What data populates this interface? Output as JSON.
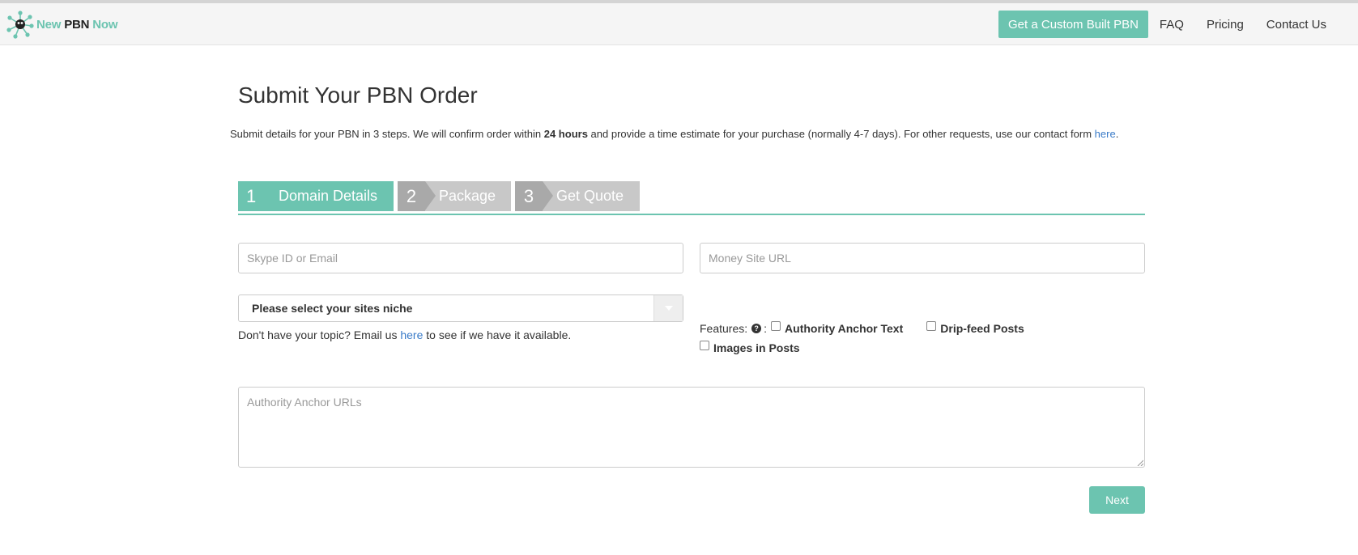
{
  "navbar": {
    "brand": {
      "part1": "New",
      "part2": "PBN",
      "part3": "Now"
    },
    "cta_label": "Get a Custom Built PBN",
    "links": [
      "FAQ",
      "Pricing",
      "Contact Us"
    ]
  },
  "page": {
    "title": "Submit Your PBN Order",
    "intro": {
      "before": "Submit details for your PBN in 3 steps. We will confirm order within ",
      "bold": "24 hours",
      "after": " and provide a time estimate for your purchase (normally 4-7 days). For other requests, use our contact form ",
      "link": "here",
      "end": "."
    }
  },
  "steps": [
    {
      "num": "1",
      "label": "Domain Details",
      "active": true
    },
    {
      "num": "2",
      "label": "Package",
      "active": false
    },
    {
      "num": "3",
      "label": "Get Quote",
      "active": false
    }
  ],
  "form": {
    "skype_placeholder": "Skype ID or Email",
    "money_placeholder": "Money Site URL",
    "niche_selected": "Please select your sites niche",
    "help": {
      "before": "Don't have your topic? Email us ",
      "link": "here",
      "after": " to see if we have it available."
    },
    "features_label": "Features:",
    "features_sep": ":",
    "features": [
      "Authority Anchor Text",
      "Drip-feed Posts",
      "Images in Posts"
    ],
    "anchor_urls_placeholder": "Authority Anchor URLs",
    "next_label": "Next"
  },
  "colors": {
    "accent": "#6cc4b0",
    "step_inactive": "#c8c8c8",
    "step_num_inactive": "#a9a9a9",
    "link": "#3a7bc8"
  }
}
